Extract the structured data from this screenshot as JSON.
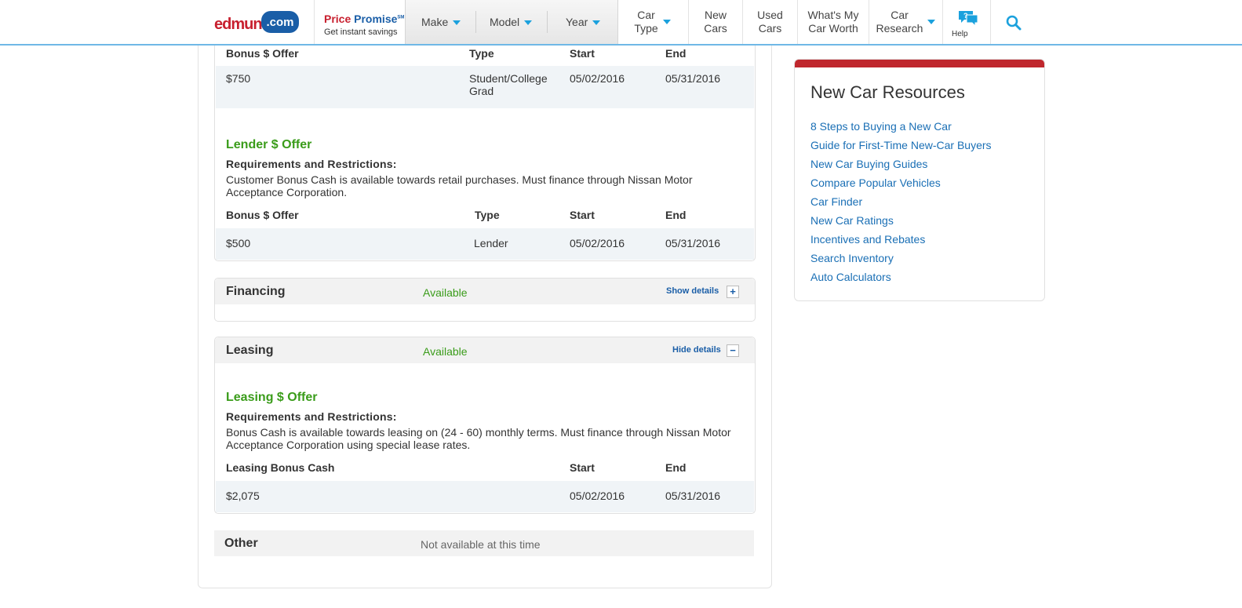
{
  "header": {
    "logo_word": "edmunds",
    "logo_dotcom": ".com",
    "price_promise": {
      "price": "Price",
      "promise": "Promise",
      "sm": "SM",
      "subtitle": "Get instant savings"
    },
    "selectors": [
      "Make",
      "Model",
      "Year"
    ],
    "nav": [
      {
        "line1": "Car",
        "line2": "Type",
        "caret": true
      },
      {
        "line1": "New",
        "line2": "Cars",
        "caret": false
      },
      {
        "line1": "Used",
        "line2": "Cars",
        "caret": false
      },
      {
        "line1": "What's My",
        "line2": "Car Worth",
        "caret": false
      },
      {
        "line1": "Car",
        "line2": "Research",
        "caret": true
      }
    ],
    "help_label": "Help",
    "help_icon": "help-chat-icon",
    "search_icon": "search-icon",
    "accent_color": "#1ba1dd"
  },
  "student_offer": {
    "headers": {
      "offer": "Bonus $ Offer",
      "type": "Type",
      "start": "Start",
      "end": "End"
    },
    "row": {
      "amount": "$750",
      "type": "Student/College Grad",
      "start": "05/02/2016",
      "end": "05/31/2016"
    }
  },
  "lender_offer": {
    "title": "Lender $ Offer",
    "req_label": "Requirements and Restrictions:",
    "req_text": "Customer Bonus Cash is available towards retail purchases. Must finance through Nissan Motor Acceptance Corporation.",
    "headers": {
      "offer": "Bonus $ Offer",
      "type": "Type",
      "start": "Start",
      "end": "End"
    },
    "row": {
      "amount": "$500",
      "type": "Lender",
      "start": "05/02/2016",
      "end": "05/31/2016"
    }
  },
  "financing": {
    "title": "Financing",
    "status": "Available",
    "toggle": "Show details",
    "toggle_symbol": "+"
  },
  "leasing": {
    "title": "Leasing",
    "status": "Available",
    "toggle": "Hide details",
    "toggle_symbol": "−",
    "offer_title": "Leasing $ Offer",
    "req_label": "Requirements and Restrictions:",
    "req_text": "Bonus Cash is available towards leasing on (24 - 60) monthly terms. Must finance through Nissan Motor Acceptance Corporation using special lease rates.",
    "headers": {
      "offer": "Leasing Bonus Cash",
      "start": "Start",
      "end": "End"
    },
    "row": {
      "amount": "$2,075",
      "start": "05/02/2016",
      "end": "05/31/2016"
    }
  },
  "other": {
    "title": "Other",
    "status": "Not available at this time"
  },
  "resources": {
    "title": "New Car Resources",
    "links": [
      "8 Steps to Buying a New Car",
      "Guide for First-Time New-Car Buyers",
      "New Car Buying Guides",
      "Compare Popular Vehicles",
      "Car Finder",
      "New Car Ratings",
      "Incentives and Rebates",
      "Search Inventory",
      "Auto Calculators"
    ]
  }
}
